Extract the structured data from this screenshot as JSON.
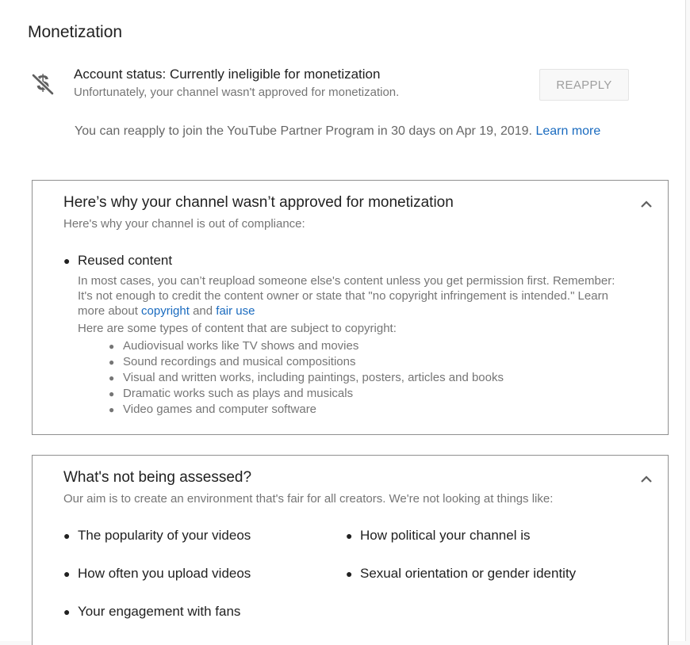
{
  "header": {
    "title": "Monetization"
  },
  "status": {
    "icon": "no-money-icon",
    "title": "Account status: Currently ineligible for monetization",
    "subtitle": "Unfortunately, your channel wasn't approved for monetization.",
    "reapply_label": "REAPPLY",
    "note": "You can reapply to join the YouTube Partner Program in 30 days on Apr 19, 2019.",
    "learn_more": "Learn more"
  },
  "why_card": {
    "title": "Here’s why your channel wasn’t approved for monetization",
    "subtitle": "Here's why your channel is out of compliance:",
    "reason": "Reused content",
    "detail_line1": "In most cases, you can’t reupload someone else's content unless you get permission first. Remember:",
    "detail_line2": "It's not enough to credit the content owner or state that \"no copyright infringement is intended.\" Learn",
    "detail_line3_prefix": "more about ",
    "copyright_link": "copyright",
    "and_text": " and ",
    "fair_use_link": "fair use",
    "types_intro": "Here are some types of content that are subject to copyright:",
    "types": [
      "Audiovisual works like TV shows and movies",
      "Sound recordings and musical compositions",
      "Visual and written works, including paintings, posters, articles and books",
      "Dramatic works such as plays and musicals",
      "Video games and computer software"
    ]
  },
  "not_assessed_card": {
    "title": "What's not being assessed?",
    "subtitle": "Our aim is to create an environment that's fair for all creators. We're not looking at things like:",
    "items": [
      "The popularity of your videos",
      "How political your channel is",
      "How often you upload videos",
      "Sexual orientation or gender identity",
      "Your engagement with fans"
    ]
  },
  "colors": {
    "link": "#1a6bbf",
    "text": "#212121",
    "secondary": "#757575"
  }
}
